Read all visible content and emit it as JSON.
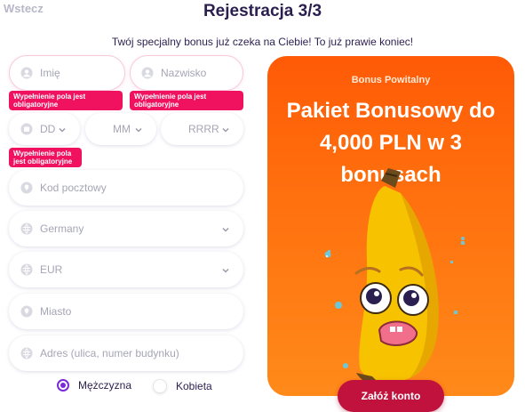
{
  "header": {
    "back_label": "Wstecz",
    "title": "Rejestracja 3/3",
    "subtitle": "Twój specjalny bonus już czeka na Ciebie! To już prawie koniec!"
  },
  "form": {
    "first_name": {
      "placeholder": "Imię",
      "icon": "user-icon"
    },
    "last_name": {
      "placeholder": "Nazwisko",
      "icon": "user-icon"
    },
    "dob_day": {
      "value": "DD",
      "icon": "calendar-icon"
    },
    "dob_month": {
      "value": "MM"
    },
    "dob_year": {
      "value": "RRRR"
    },
    "postal_code": {
      "placeholder": "Kod pocztowy",
      "icon": "location-icon"
    },
    "country": {
      "value": "Germany",
      "icon": "globe-icon"
    },
    "currency": {
      "value": "EUR",
      "icon": "globe-icon"
    },
    "city": {
      "placeholder": "Miasto",
      "icon": "location-icon"
    },
    "address": {
      "placeholder": "Adres (ulica, numer budynku)",
      "icon": "globe-icon"
    },
    "error_message": "Wypełnienie pola jest obligatoryjne",
    "gender": {
      "male_label": "Mężczyzna",
      "female_label": "Kobieta",
      "selected": "male"
    }
  },
  "promo": {
    "label": "Bonus Powitalny",
    "headline": "Pakiet Bonusowy do 4,000 PLN w 3 bonusach"
  },
  "cta": {
    "label": "Załóż konto"
  },
  "colors": {
    "accent_purple": "#7a2bd8",
    "error_pink": "#f0115f",
    "promo_orange": "#ff6d0d",
    "cta_red": "#c0123c"
  }
}
